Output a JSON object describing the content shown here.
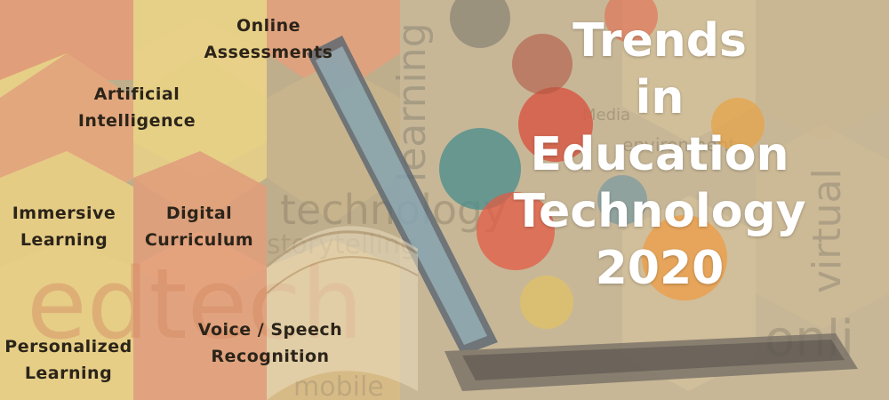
{
  "title": {
    "line1": "Trends",
    "line2": "in",
    "line3": "Education",
    "line4": "Technology",
    "line5": "2020"
  },
  "trends": [
    {
      "line1": "Online",
      "line2": "Assessments"
    },
    {
      "line1": "Artificial",
      "line2": "Intelligence"
    },
    {
      "line1": "Immersive",
      "line2": "Learning"
    },
    {
      "line1": "Digital",
      "line2": "Curriculum"
    },
    {
      "line1": "Personalized",
      "line2": "Learning"
    },
    {
      "line1": "Voice / Speech",
      "line2": "Recognition"
    }
  ],
  "background_words": [
    "technology",
    "storytelling",
    "learning",
    "edtech",
    "online",
    "virtual",
    "mobile",
    "environment",
    "Media"
  ],
  "colors": {
    "hex_orange": "#e3a27d",
    "hex_yellow": "#e6cf86",
    "hex_tan": "#cdb88c",
    "title_text": "#ffffff",
    "label_text": "#2b2419"
  },
  "icons": [
    "laptop-icon",
    "open-book-icon",
    "microscope-icon",
    "trophy-icon",
    "lightbulb-icon",
    "globe-icon",
    "flask-icon",
    "book-icon"
  ]
}
